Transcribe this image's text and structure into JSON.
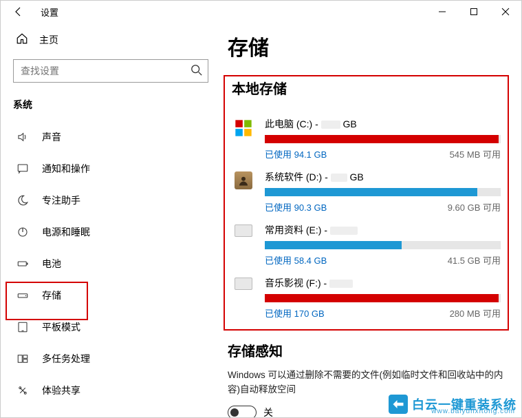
{
  "titlebar": {
    "app_title": "设置"
  },
  "sidebar": {
    "home_label": "主页",
    "search_placeholder": "查找设置",
    "category_label": "系统",
    "items": [
      {
        "label": "声音"
      },
      {
        "label": "通知和操作"
      },
      {
        "label": "专注助手"
      },
      {
        "label": "电源和睡眠"
      },
      {
        "label": "电池"
      },
      {
        "label": "存储"
      },
      {
        "label": "平板模式"
      },
      {
        "label": "多任务处理"
      },
      {
        "label": "体验共享"
      }
    ]
  },
  "content": {
    "page_title": "存储",
    "local_section": "本地存储",
    "drives": [
      {
        "name": "此电脑 (C:) - ",
        "size_suffix": " GB",
        "used_label": "已使用 94.1 GB",
        "free_label": "545 MB 可用",
        "fill_color": "red",
        "fill_pct": 99
      },
      {
        "name": "系统软件 (D:) - ",
        "size_suffix": " GB",
        "used_label": "已使用 90.3 GB",
        "free_label": "9.60 GB 可用",
        "fill_color": "blue",
        "fill_pct": 90
      },
      {
        "name": "常用资料 (E:) - ",
        "size_suffix": "",
        "used_label": "已使用 58.4 GB",
        "free_label": "41.5 GB 可用",
        "fill_color": "blue",
        "fill_pct": 58
      },
      {
        "name": "音乐影视 (F:) - ",
        "size_suffix": "",
        "used_label": "已使用 170 GB",
        "free_label": "280 MB 可用",
        "fill_color": "red",
        "fill_pct": 99
      }
    ],
    "sense_title": "存储感知",
    "sense_desc": "Windows 可以通过删除不需要的文件(例如临时文件和回收站中的内容)自动释放空间",
    "toggle_label": "关"
  },
  "watermark": {
    "brand": "白云一键重装系统",
    "url": "www.baiyunxitong.com"
  }
}
